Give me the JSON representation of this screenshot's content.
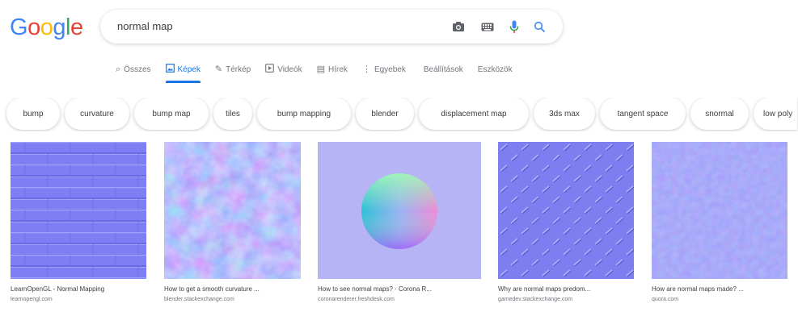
{
  "logo": [
    "G",
    "o",
    "o",
    "g",
    "l",
    "e"
  ],
  "logo_colors": [
    "#4285F4",
    "#EA4335",
    "#FBBC05",
    "#4285F4",
    "#34A853",
    "#EA4335"
  ],
  "search": {
    "query": "normal map",
    "icons": [
      "camera-icon",
      "keyboard-icon",
      "mic-icon",
      "search-icon"
    ]
  },
  "tabs": [
    {
      "label": "Összes",
      "icon": "search-icon",
      "glyph": "⌕",
      "active": false
    },
    {
      "label": "Képek",
      "icon": "image-icon",
      "glyph": "🖾",
      "active": true
    },
    {
      "label": "Térkép",
      "icon": "map-icon",
      "glyph": "✎",
      "active": false
    },
    {
      "label": "Videók",
      "icon": "play-icon",
      "glyph": "▶",
      "active": false
    },
    {
      "label": "Hírek",
      "icon": "news-icon",
      "glyph": "▤",
      "active": false
    },
    {
      "label": "Egyebek",
      "icon": "more-icon",
      "glyph": "⋮",
      "active": false
    },
    {
      "label": "Beállítások",
      "icon": "",
      "glyph": "",
      "active": false
    },
    {
      "label": "Eszközök",
      "icon": "",
      "glyph": "",
      "active": false
    }
  ],
  "chips": [
    "bump",
    "curvature",
    "bump map",
    "tiles",
    "bump mapping",
    "blender",
    "displacement map",
    "3ds max",
    "tangent space",
    "snormal",
    "low poly"
  ],
  "results": [
    {
      "title": "LearnOpenGL - Normal Mapping",
      "source": "learnopengl.com"
    },
    {
      "title": "How to get a smooth curvature ...",
      "source": "blender.stackexchange.com"
    },
    {
      "title": "How to see normal maps? · Corona R...",
      "source": "coronarenderer.freshdesk.com"
    },
    {
      "title": "Why are normal maps predom...",
      "source": "gamedev.stackexchange.com"
    },
    {
      "title": "How are normal maps made? ...",
      "source": "quora.com"
    }
  ],
  "colors": {
    "accent": "#1a73e8",
    "normal_map_base": "#7f7fff",
    "normal_map_light": "#8a90ff",
    "normal_map_dark": "#6a6ae8",
    "sphere_bg": "#b7b4f6"
  }
}
